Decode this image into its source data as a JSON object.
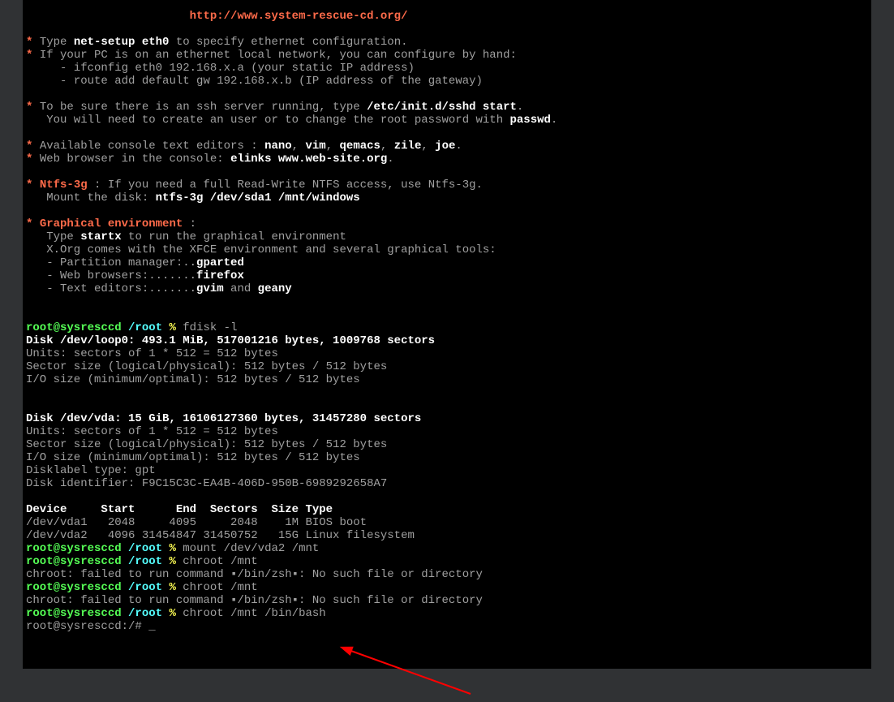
{
  "header": {
    "url": "http://www.system-rescue-cd.org/"
  },
  "intro": {
    "b1_pre": "Type ",
    "b1_cmd": "net-setup eth0",
    "b1_post": " to specify ethernet configuration.",
    "b2": "If your PC is on an ethernet local network, you can configure by hand:",
    "b2a": "   - ifconfig eth0 192.168.x.a (your static IP address)",
    "b2b": "   - route add default gw 192.168.x.b (IP address of the gateway)",
    "ssh_pre": "To be sure there is an ssh server running, type ",
    "ssh_cmd": "/etc/init.d/sshd start",
    "ssh_post": ".",
    "ssh2_pre": "   You will need to create an user or to change the root password with ",
    "ssh2_cmd": "passwd",
    "ssh2_post": ".",
    "editors_pre": "Available console text editors : ",
    "e": {
      "nano": "nano",
      "vim": "vim",
      "qemacs": "qemacs",
      "zile": "zile",
      "joe": "joe"
    },
    "browser_pre": "Web browser in the console: ",
    "browser_cmd": "elinks www.web-site.org",
    "ntfs_label": "Ntfs-3g",
    "ntfs_rest": " : If you need a full Read-Write NTFS access, use Ntfs-3g.",
    "ntfs_mount_pre": "   Mount the disk: ",
    "ntfs_mount_cmd": "ntfs-3g /dev/sda1 /mnt/windows",
    "env_label": "Graphical environment",
    "env_colon": " :",
    "startx_pre": "   Type ",
    "startx_cmd": "startx",
    "startx_post": " to run the graphical environment",
    "xorg": "   X.Org comes with the XFCE environment and several graphical tools:",
    "part_pre": "   - Partition manager:..",
    "part_cmd": "gparted",
    "wb_pre": "   - Web browsers:.......",
    "wb_cmd": "firefox",
    "te_pre": "   - Text editors:.......",
    "te_cmd1": "gvim",
    "te_mid": " and ",
    "te_cmd2": "geany"
  },
  "prompt": {
    "userhost": "root@sysresccd",
    "path": "/root",
    "pct": " % ",
    "bash": "root@sysresccd:/# "
  },
  "cmds": {
    "fdisk": "fdisk -l",
    "mount": "mount /dev/vda2 /mnt",
    "chroot1": "chroot /mnt",
    "chroot2": "chroot /mnt /bin/bash"
  },
  "fdisk": {
    "loop0": "Disk /dev/loop0: 493.1 MiB, 517001216 bytes, 1009768 sectors",
    "units": "Units: sectors of 1 * 512 = 512 bytes",
    "sector": "Sector size (logical/physical): 512 bytes / 512 bytes",
    "io": "I/O size (minimum/optimal): 512 bytes / 512 bytes",
    "vda": "Disk /dev/vda: 15 GiB, 16106127360 bytes, 31457280 sectors",
    "label": "Disklabel type: gpt",
    "ident": "Disk identifier: F9C15C3C-EA4B-406D-950B-6989292658A7",
    "hdr": "Device     Start      End  Sectors  Size Type",
    "p1": "/dev/vda1   2048     4095     2048    1M BIOS boot",
    "p2": "/dev/vda2   4096 31454847 31450752   15G Linux filesystem"
  },
  "errs": {
    "chroot": "chroot: failed to run command ▪/bin/zsh▪: No such file or directory"
  },
  "cursor": "_"
}
